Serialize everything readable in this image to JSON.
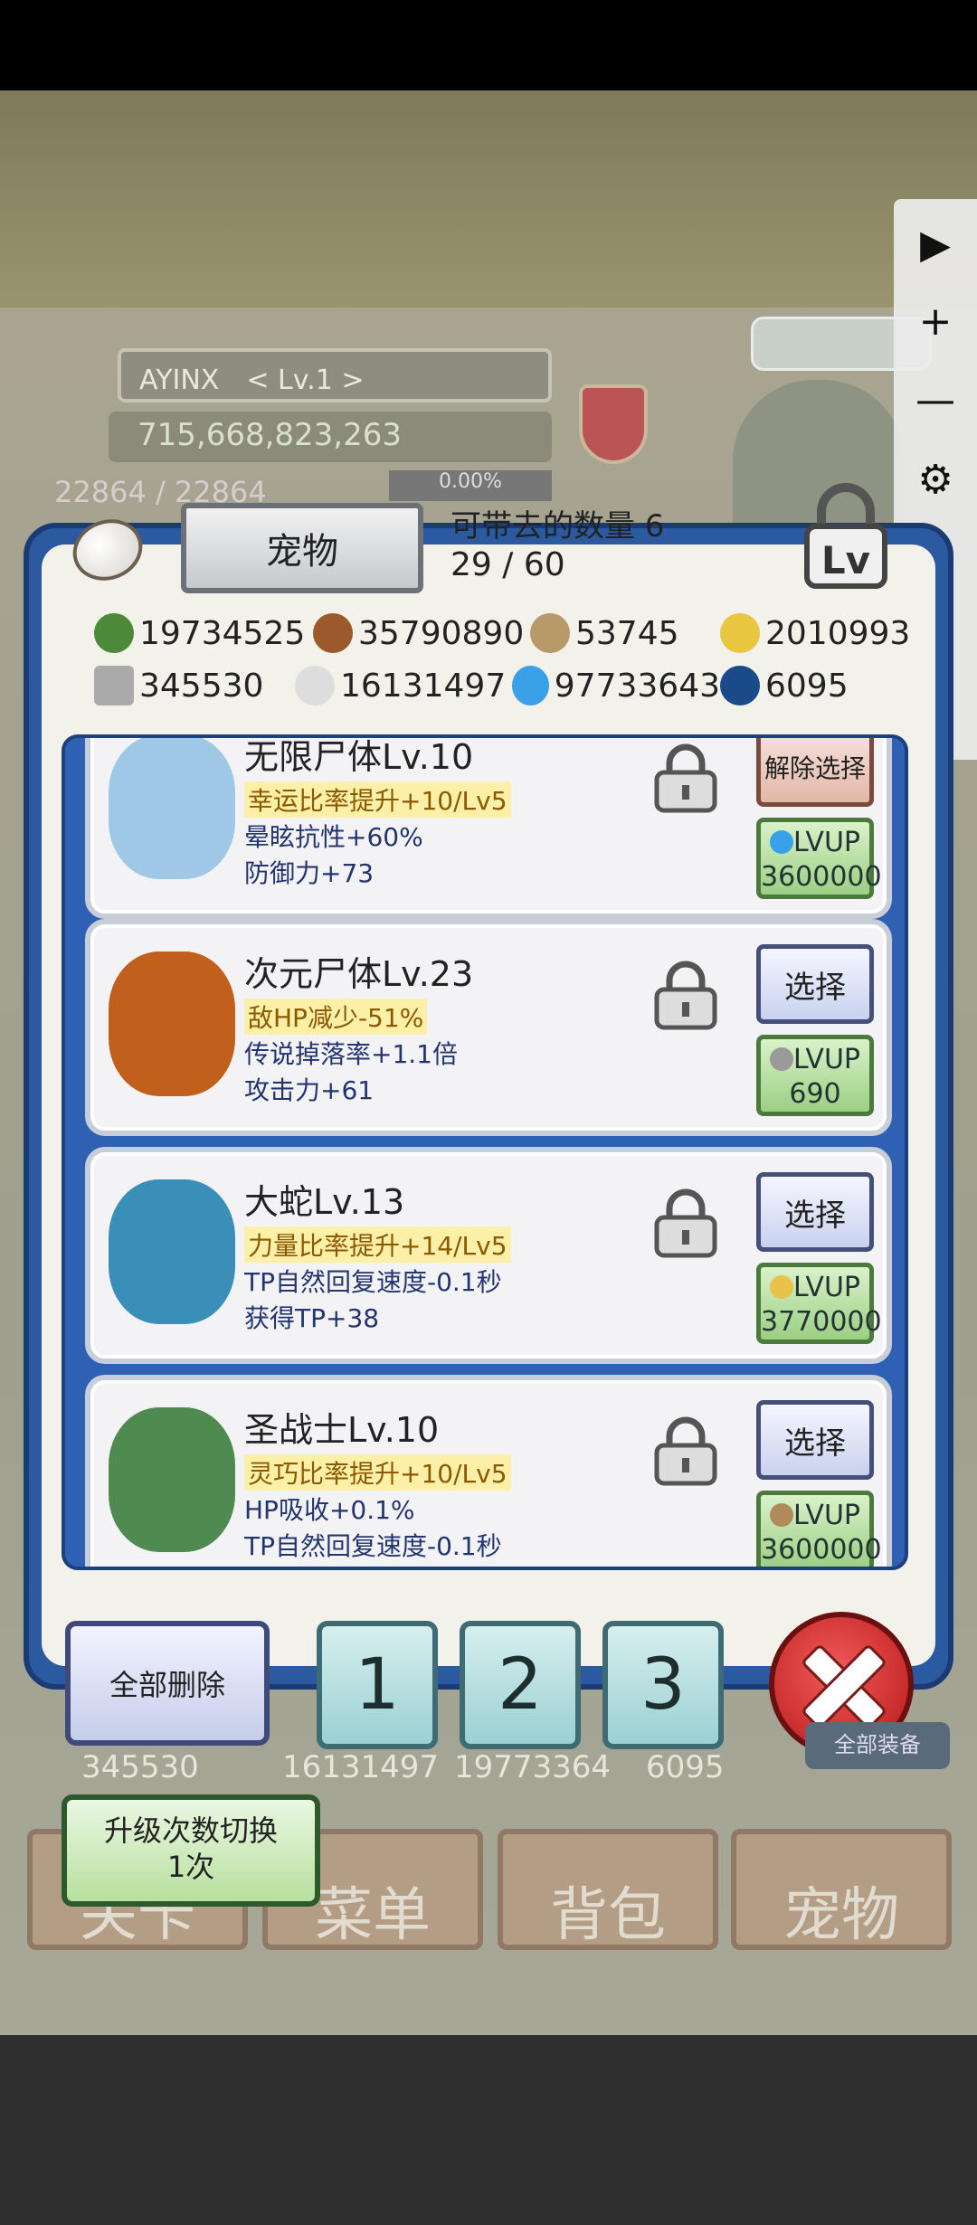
{
  "hud_background": {
    "player_name": "AYINX　< Lv.1 >",
    "gold": "715,668,823,263",
    "hp": "22864 / 22864",
    "exp": "0.00%"
  },
  "toolbar": {
    "icons": [
      "play-icon",
      "plus-icon",
      "minus-icon",
      "gear-icon",
      "eye-icon",
      "move-icon",
      "close-icon"
    ],
    "glyphs": [
      "▶",
      "+",
      "—",
      "⚙",
      "👁",
      "✥",
      "✕"
    ]
  },
  "dialog": {
    "title": "宠物",
    "carry_label": "可带去的数量 6",
    "carry_ratio": "29 / 60",
    "resources_row1": [
      "19734525",
      "35790890",
      "53745",
      "2010993"
    ],
    "resources_row2": [
      "345530",
      "16131497",
      "97733643",
      "6095"
    ]
  },
  "pets": [
    {
      "name": "无限尸体Lv.10",
      "stat1": "幸运比率提升+10/Lv5",
      "stat2": "晕眩抗性+60%",
      "stat3": "防御力+73",
      "button": "解除选择",
      "lvup_label": "LVUP",
      "lvup_cost": "3600000",
      "avatar_color": "#9fc8e6",
      "cost_icon_color": "#3aa0e8"
    },
    {
      "name": "次元尸体Lv.23",
      "stat1": "敌HP减少-51%",
      "stat2": "传说掉落率+1.1倍",
      "stat3": "攻击力+61",
      "button": "选择",
      "lvup_label": "LVUP",
      "lvup_cost": "690",
      "avatar_color": "#c0601c",
      "cost_icon_color": "#9a9a9a"
    },
    {
      "name": "大蛇Lv.13",
      "stat1": "力量比率提升+14/Lv5",
      "stat2": "TP自然回复速度-0.1秒",
      "stat3": "获得TP+38",
      "button": "选择",
      "lvup_label": "LVUP",
      "lvup_cost": "3770000",
      "avatar_color": "#3a8fb8",
      "cost_icon_color": "#e8c24a"
    },
    {
      "name": "圣战士Lv.10",
      "stat1": "灵巧比率提升+10/Lv5",
      "stat2": "HP吸收+0.1%",
      "stat3": "TP自然回复速度-0.1秒",
      "button": "选择",
      "lvup_label": "LVUP",
      "lvup_cost": "3600000",
      "avatar_color": "#4f8a50",
      "cost_icon_color": "#b08a5a"
    }
  ],
  "controls": {
    "delete_all": "全部删除",
    "slot1": "1",
    "slot2": "2",
    "slot3": "3"
  },
  "bottom_background": {
    "res1": "345530",
    "res2": "16131497",
    "res3": "19773364",
    "res4": "6095",
    "equip_label": "全部装备",
    "upgrade_toggle_line1": "升级次数切换",
    "upgrade_toggle_line2": "1次",
    "tabs": [
      "关卡",
      "菜单",
      "背包",
      "宠物"
    ]
  }
}
